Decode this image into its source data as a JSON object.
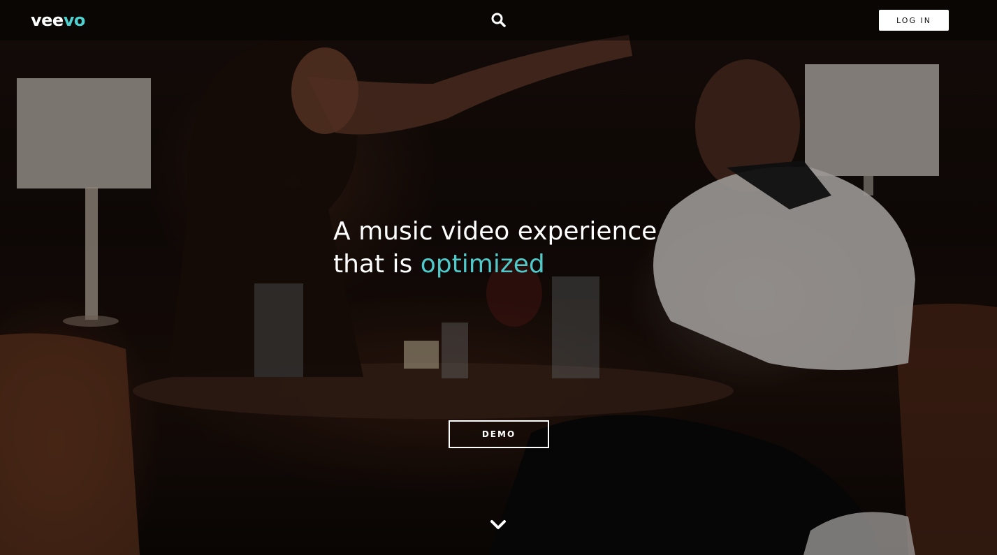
{
  "header": {
    "logo_text": "veevo",
    "logo_prefix": "vee",
    "logo_suffix": "vo",
    "search_icon": "search-icon",
    "login_label": "LOG IN"
  },
  "hero": {
    "headline_line1": "A music video experience",
    "headline_line2_prefix": "that is ",
    "headline_highlight": "optimized",
    "demo_label": "DEMO",
    "scroll_icon": "chevron-down-icon"
  },
  "colors": {
    "accent": "#4fc9c9",
    "button_bg": "#ffffff",
    "header_bg": "rgba(0,0,0,0.45)"
  }
}
